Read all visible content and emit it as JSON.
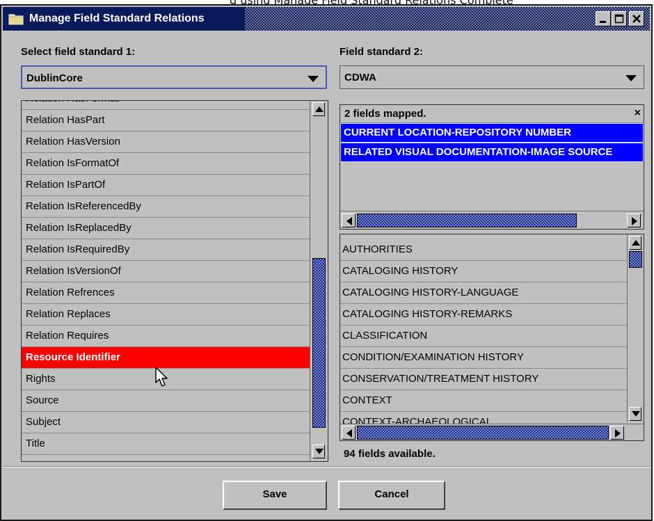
{
  "window": {
    "title": "Manage Field Standard Relations",
    "controls": [
      "minimize-icon",
      "maximize-icon",
      "close-icon"
    ]
  },
  "background_sliver_text": "g using Manage Field Standard Relations Complete",
  "left": {
    "label": "Select field standard 1:",
    "selected": "DublinCore",
    "partial_top_item": "Relation HasFormat",
    "items": [
      "Relation HasPart",
      "Relation HasVersion",
      "Relation IsFormatOf",
      "Relation IsPartOf",
      "Relation IsReferencedBy",
      "Relation IsReplacedBy",
      "Relation IsRequiredBy",
      "Relation IsVersionOf",
      "Relation Refrences",
      "Relation Replaces",
      "Relation Requires",
      "Resource Identifier",
      "Rights",
      "Source",
      "Subject",
      "Title"
    ],
    "selected_index": 11
  },
  "right": {
    "label": "Field standard 2:",
    "selected": "CDWA",
    "mapped_header": "2 fields mapped.",
    "mapped_close": "×",
    "mapped": [
      "CURRENT LOCATION-REPOSITORY NUMBER",
      "RELATED VISUAL DOCUMENTATION-IMAGE SOURCE"
    ],
    "available": [
      "AUTHORITIES",
      "CATALOGING HISTORY",
      "CATALOGING HISTORY-LANGUAGE",
      "CATALOGING HISTORY-REMARKS",
      "CLASSIFICATION",
      "CONDITION/EXAMINATION HISTORY",
      "CONSERVATION/TREATMENT HISTORY",
      "CONTEXT",
      "CONTEXT-ARCHAEOLOGICAL"
    ],
    "status": "94 fields available."
  },
  "buttons": {
    "save": "Save",
    "cancel": "Cancel"
  },
  "colors": {
    "titlebar": "#0a1a5a",
    "selection_red": "#ff0000",
    "mapped_blue": "#0000ff",
    "panel": "#c0c0c0"
  }
}
